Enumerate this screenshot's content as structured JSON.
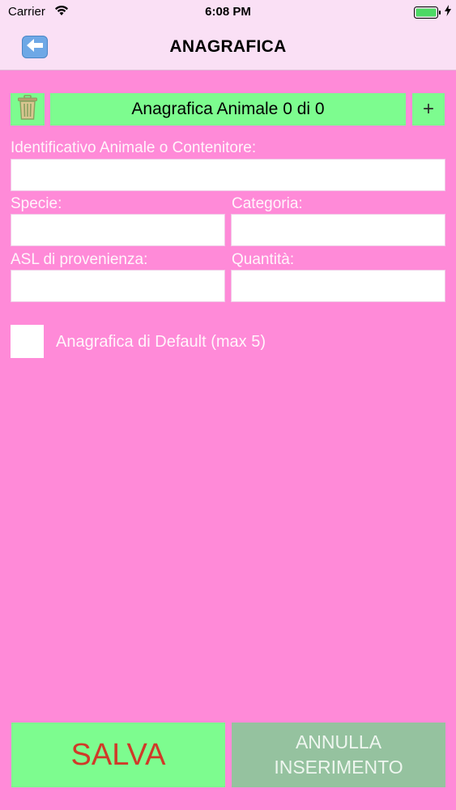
{
  "status_bar": {
    "carrier": "Carrier",
    "time": "6:08 PM",
    "wifi_icon": "wifi-icon",
    "battery_icon": "battery-icon",
    "charging_icon": "bolt-icon"
  },
  "nav": {
    "title": "ANAGRAFICA",
    "back_icon": "back-arrow-icon"
  },
  "record": {
    "header": "Anagrafica Animale 0 di 0",
    "delete_icon": "trash-icon",
    "add_label": "+"
  },
  "form": {
    "identifier_label": "Identificativo Animale o Contenitore:",
    "identifier_value": "",
    "species_label": "Specie:",
    "species_value": "",
    "category_label": "Categoria:",
    "category_value": "",
    "asl_label": "ASL di provenienza:",
    "asl_value": "",
    "quantity_label": "Quantità:",
    "quantity_value": "",
    "default_checkbox_label": "Anagrafica di Default (max 5)",
    "default_checked": false
  },
  "actions": {
    "save_label": "SALVA",
    "cancel_label": "ANNULLA\nINSERIMENTO"
  },
  "colors": {
    "background": "#ff8ad8",
    "bar": "#fae0f5",
    "accent_green": "#7dfc8f",
    "disabled_green": "#95c29f",
    "save_text": "#d03a28"
  }
}
